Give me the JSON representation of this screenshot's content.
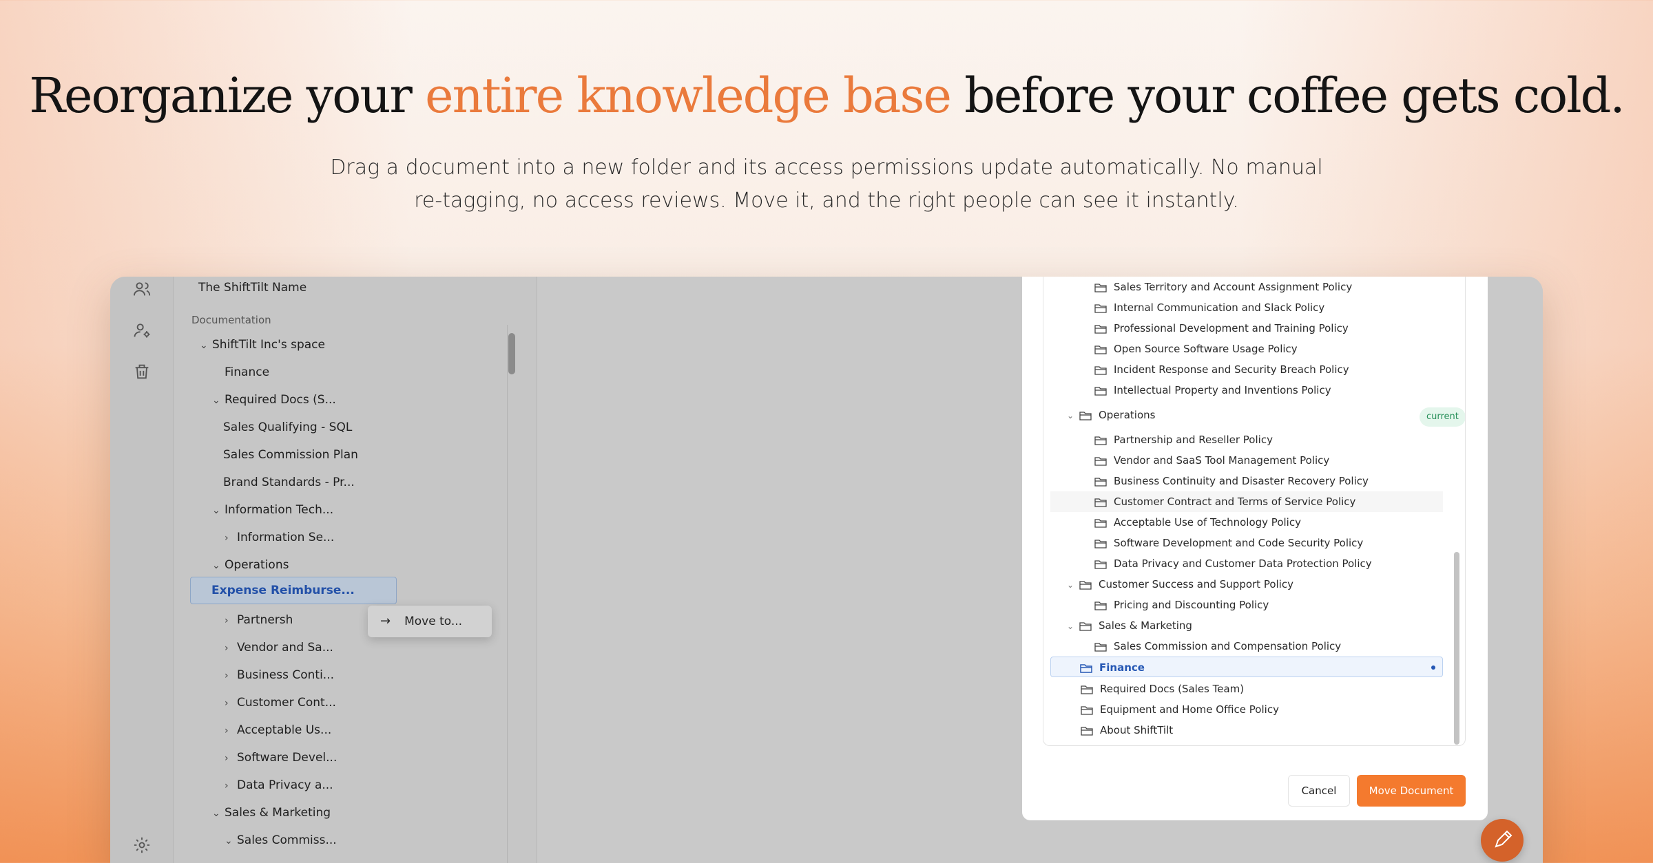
{
  "hero": {
    "headline_before": "Reorganize your ",
    "headline_accent": "entire knowledge base",
    "headline_after": " before your coffee gets cold.",
    "subhead": "Drag a document into a new folder and its access permissions update automatically. No manual re-tagging, no access reviews. Move it, and the right people can see it instantly."
  },
  "colors": {
    "accent": "#ea7a3c",
    "primary_button": "#f47a2e",
    "current_badge": "#28905a",
    "selection": "#2557b4"
  },
  "rail": {
    "icons": [
      "users-icon",
      "user-settings-icon",
      "trash-icon",
      "settings-icon"
    ]
  },
  "sidebar": {
    "title": "The ShiftTilt Name",
    "section": "Documentation",
    "items": [
      {
        "label": "ShiftTilt Inc's space",
        "chev": "⌄"
      },
      {
        "label": "Finance",
        "chev": ""
      },
      {
        "label": "Required Docs (S...",
        "chev": "⌄"
      },
      {
        "label": "Sales Qualifying - SQL",
        "chev": ""
      },
      {
        "label": "Sales Commission Plan",
        "chev": ""
      },
      {
        "label": "Brand Standards - Pr...",
        "chev": ""
      },
      {
        "label": "Information Tech...",
        "chev": "⌄"
      },
      {
        "label": "Information Se...",
        "chev": "›"
      },
      {
        "label": "Operations",
        "chev": "⌄"
      },
      {
        "label": "Expense Reimburse...",
        "chev": ""
      },
      {
        "label": "Partnersh",
        "chev": "›"
      },
      {
        "label": "Vendor and Sa...",
        "chev": "›"
      },
      {
        "label": "Business Conti...",
        "chev": "›"
      },
      {
        "label": "Customer Cont...",
        "chev": "›"
      },
      {
        "label": "Acceptable Us...",
        "chev": "›"
      },
      {
        "label": "Software Devel...",
        "chev": "›"
      },
      {
        "label": "Data Privacy a...",
        "chev": "›"
      },
      {
        "label": "Sales & Marketing",
        "chev": "⌄"
      },
      {
        "label": "Sales Commiss...",
        "chev": "⌄"
      }
    ],
    "context_menu": {
      "arrow": "→",
      "label": "Move to..."
    }
  },
  "modal": {
    "rows": [
      {
        "label": "Sales Territory and Account Assignment Policy",
        "chev": ""
      },
      {
        "label": "Internal Communication and Slack Policy",
        "chev": ""
      },
      {
        "label": "Professional Development and Training Policy",
        "chev": ""
      },
      {
        "label": "Open Source Software Usage Policy",
        "chev": ""
      },
      {
        "label": "Incident Response and Security Breach Policy",
        "chev": ""
      },
      {
        "label": "Intellectual Property and Inventions Policy",
        "chev": ""
      },
      {
        "label": "Operations",
        "chev": "⌄"
      },
      {
        "label": "Partnership and Reseller Policy",
        "chev": ""
      },
      {
        "label": "Vendor and SaaS Tool Management Policy",
        "chev": ""
      },
      {
        "label": "Business Continuity and Disaster Recovery Policy",
        "chev": ""
      },
      {
        "label": "Customer Contract and Terms of Service Policy",
        "chev": ""
      },
      {
        "label": "Acceptable Use of Technology Policy",
        "chev": ""
      },
      {
        "label": "Software Development and Code Security Policy",
        "chev": ""
      },
      {
        "label": "Data Privacy and Customer Data Protection Policy",
        "chev": ""
      },
      {
        "label": "Customer Success and Support Policy",
        "chev": "⌄"
      },
      {
        "label": "Pricing and Discounting Policy",
        "chev": ""
      },
      {
        "label": "Sales & Marketing",
        "chev": "⌄"
      },
      {
        "label": "Sales Commission and Compensation Policy",
        "chev": ""
      },
      {
        "label": "Finance",
        "chev": ""
      },
      {
        "label": "Required Docs (Sales Team)",
        "chev": ""
      },
      {
        "label": "Equipment and Home Office Policy",
        "chev": ""
      },
      {
        "label": "About ShiftTilt",
        "chev": ""
      }
    ],
    "current_badge": "current",
    "cancel_label": "Cancel",
    "move_label": "Move Document"
  }
}
